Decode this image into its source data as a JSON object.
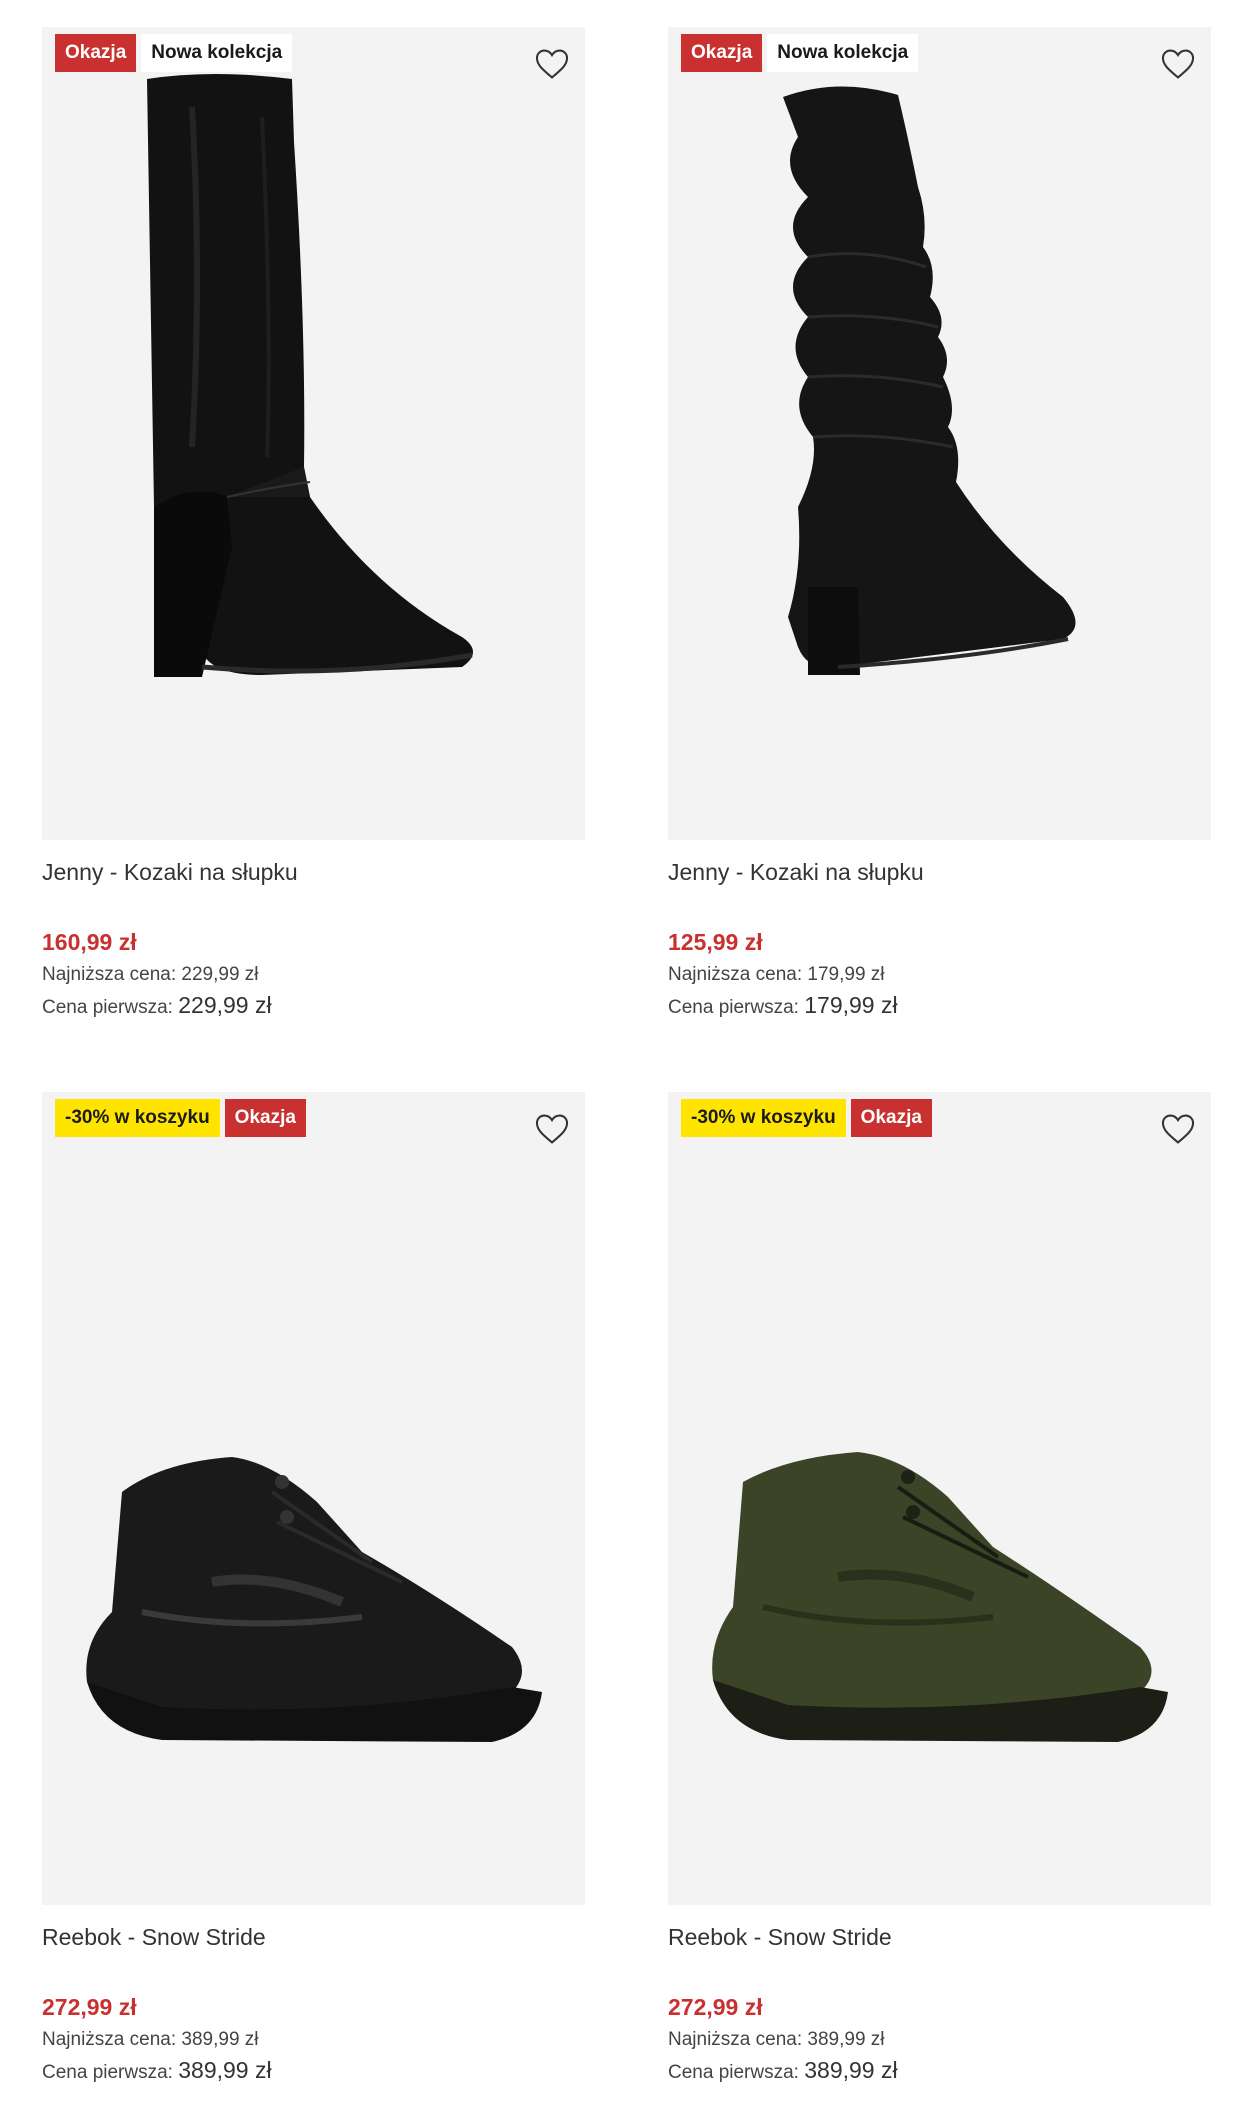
{
  "products": [
    {
      "badges": [
        "Okazja",
        "Nowa kolekcja"
      ],
      "name": "Jenny - Kozaki na słupku",
      "price": "160,99 zł",
      "lowest_label": "Najniższa cena:",
      "lowest_value": "229,99 zł",
      "first_label": "Cena pierwsza:",
      "first_value": "229,99 zł",
      "image": "black-leather-knee-high-boot"
    },
    {
      "badges": [
        "Okazja",
        "Nowa kolekcja"
      ],
      "name": "Jenny - Kozaki na słupku",
      "price": "125,99 zł",
      "lowest_label": "Najniższa cena:",
      "lowest_value": "179,99 zł",
      "first_label": "Cena pierwsza:",
      "first_value": "179,99 zł",
      "image": "black-suede-slouch-boot"
    },
    {
      "badges": [
        "-30% w koszyku",
        "Okazja"
      ],
      "name": "Reebok - Snow Stride",
      "price": "272,99 zł",
      "lowest_label": "Najniższa cena:",
      "lowest_value": "389,99 zł",
      "first_label": "Cena pierwsza:",
      "first_value": "389,99 zł",
      "image": "black-reebok-hiking-boot"
    },
    {
      "badges": [
        "-30% w koszyku",
        "Okazja"
      ],
      "name": "Reebok - Snow Stride",
      "price": "272,99 zł",
      "lowest_label": "Najniższa cena:",
      "lowest_value": "389,99 zł",
      "first_label": "Cena pierwsza:",
      "first_value": "389,99 zł",
      "image": "olive-reebok-hiking-boot"
    }
  ],
  "icons": {
    "favorite": "heart-outline-icon"
  },
  "colors": {
    "sale_red": "#c8312f",
    "promo_yellow": "#ffe400",
    "image_bg": "#f3f3f3"
  }
}
